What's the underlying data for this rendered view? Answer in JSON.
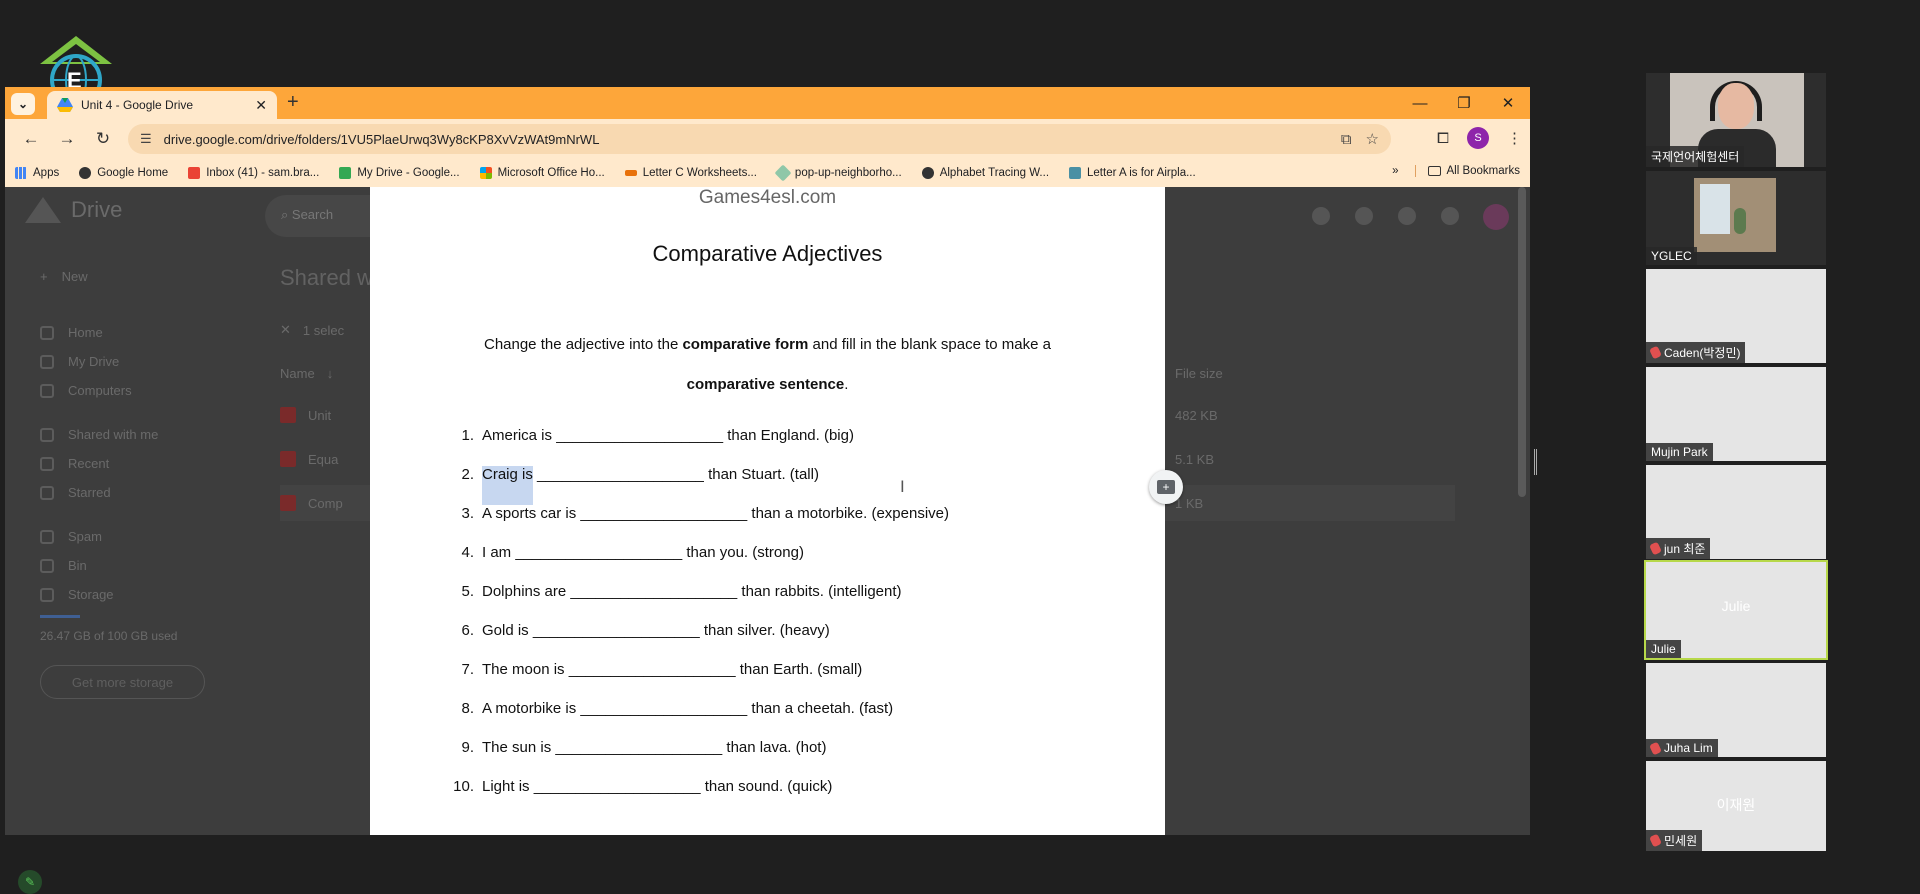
{
  "browser": {
    "tab_title": "Unit 4 - Google Drive",
    "url": "drive.google.com/drive/folders/1VU5PlaeUrwq3Wy8cKP8XvVzWAt9mNrWL",
    "profile_initial": "S",
    "accent_color": "#fda63a",
    "bookmarks": [
      {
        "label": "Apps",
        "icon": "apps-grid-icon"
      },
      {
        "label": "Google Home",
        "icon": "globe-icon"
      },
      {
        "label": "Inbox (41) - sam.bra...",
        "icon": "gmail-icon"
      },
      {
        "label": "My Drive - Google...",
        "icon": "drive-icon"
      },
      {
        "label": "Microsoft Office Ho...",
        "icon": "office-icon"
      },
      {
        "label": "Letter C Worksheets...",
        "icon": "bookmark-icon"
      },
      {
        "label": "pop-up-neighborho...",
        "icon": "tag-icon"
      },
      {
        "label": "Alphabet Tracing W...",
        "icon": "globe-icon"
      },
      {
        "label": "Letter A is for Airpla...",
        "icon": "s-icon"
      }
    ],
    "all_bookmarks": "All Bookmarks"
  },
  "drive": {
    "logo_text": "Drive",
    "search_placeholder": "Search",
    "new_label": "New",
    "header": "Shared w",
    "name_col": "Name",
    "selected_label": "1 selec",
    "file_size_col": "File size",
    "side_items": [
      "Home",
      "My Drive",
      "Computers",
      "Shared with me",
      "Recent",
      "Starred",
      "Spam",
      "Bin",
      "Storage"
    ],
    "storage_text": "26.47 GB of 100 GB used",
    "get_storage": "Get more storage",
    "files": [
      {
        "name": "Unit",
        "size": "482 KB"
      },
      {
        "name": "Equa",
        "size": "5.1 KB"
      },
      {
        "name": "Comp",
        "size": "1 KB"
      }
    ]
  },
  "worksheet": {
    "source": "Games4esl.com",
    "title": "Comparative Adjectives",
    "instruction_pre": "Change the adjective into the ",
    "instruction_bold1": "comparative form",
    "instruction_mid": " and fill in the blank space to make a",
    "instruction_bold2": "comparative sentence",
    "instruction_end": ".",
    "questions": [
      {
        "n": "1.",
        "pre": "America is",
        "post": "than England. (big)"
      },
      {
        "n": "2.",
        "pre": "Craig is",
        "post": "than Stuart. (tall)"
      },
      {
        "n": "3.",
        "pre": "A sports car is",
        "post": "than a motorbike. (expensive)"
      },
      {
        "n": "4.",
        "pre": "I am",
        "post": "than you. (strong)"
      },
      {
        "n": "5.",
        "pre": "Dolphins are",
        "post": "than rabbits. (intelligent)"
      },
      {
        "n": "6.",
        "pre": "Gold is",
        "post": "than silver. (heavy)"
      },
      {
        "n": "7.",
        "pre": "The moon is",
        "post": "than Earth. (small)"
      },
      {
        "n": "8.",
        "pre": "A motorbike is",
        "post": "than a cheetah. (fast)"
      },
      {
        "n": "9.",
        "pre": "The sun is",
        "post": "than lava. (hot)"
      },
      {
        "n": "10.",
        "pre": "Light is",
        "post": "than sound. (quick)"
      }
    ],
    "blank": "____________________"
  },
  "participants": [
    {
      "name": "국제언어체험센터",
      "muted": false,
      "kind": "video-person"
    },
    {
      "name": "YGLEC",
      "muted": false,
      "kind": "video-room"
    },
    {
      "name": "Caden(박정민)",
      "muted": true,
      "kind": "blank"
    },
    {
      "name": "Mujin Park",
      "muted": false,
      "kind": "blank"
    },
    {
      "name": "jun 최준",
      "muted": true,
      "kind": "blank"
    },
    {
      "name": "Julie",
      "muted": false,
      "kind": "active",
      "center": "Julie"
    },
    {
      "name": "Juha Lim",
      "muted": true,
      "kind": "blank"
    },
    {
      "name": "민세원",
      "muted": true,
      "kind": "blank",
      "center": "이재원"
    }
  ]
}
